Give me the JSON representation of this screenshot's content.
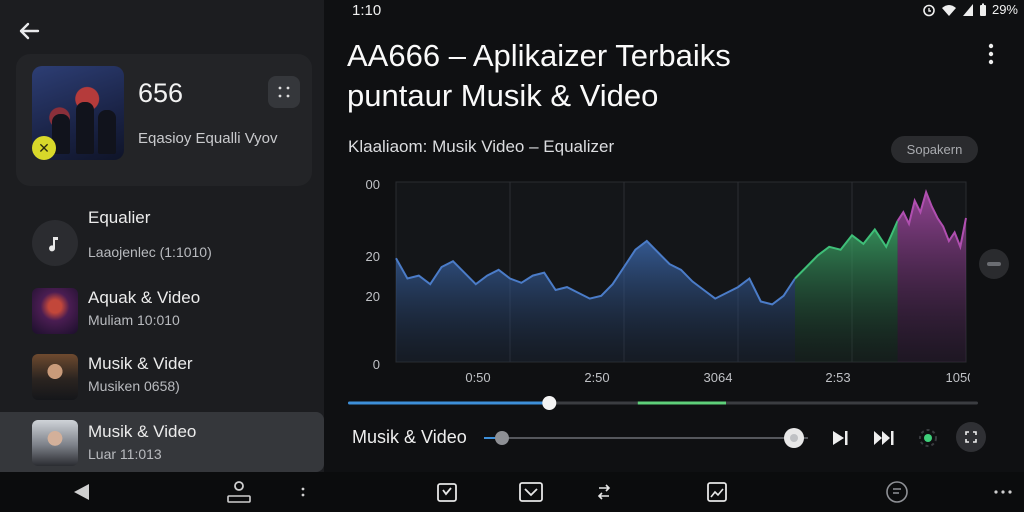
{
  "status": {
    "time": "1:10",
    "battery": "29%"
  },
  "now_playing": {
    "title": "656",
    "subtitle": "Eqasioy Equalli Vyov"
  },
  "list": [
    {
      "title": "Equalier",
      "subtitle": "Laaojenlec (1:1010)",
      "thumb": "music-note-icon"
    },
    {
      "title": "Aquak & Video",
      "subtitle": "Muliam 10:010",
      "thumb": "concert-thumb"
    },
    {
      "title": "Musik & Vider",
      "subtitle": "Musiken 0658)",
      "thumb": "portrait-thumb"
    },
    {
      "title": "Musik & Video",
      "subtitle": "Luar 11:013",
      "thumb": "portrait-thumb"
    }
  ],
  "header": {
    "title": "AA666 – Aplikaizer Terbaiks puntaur Musik & Video",
    "subtitle": "Klaaliaom: Musik Video – Equalizer",
    "chip": "Sopakern"
  },
  "chart_data": {
    "type": "area",
    "y_tick_labels": [
      "00",
      "20",
      "20",
      "0"
    ],
    "x_tick_labels": [
      "0:50",
      "2:50",
      "3064",
      "2:53",
      "1050"
    ],
    "grid": true,
    "series": [
      {
        "color": "#4b7cc8",
        "x": [
          0,
          2,
          4,
          6,
          8,
          10,
          12,
          14,
          16,
          18,
          20,
          22,
          24,
          26,
          28,
          30,
          32,
          34,
          36,
          38,
          40,
          42,
          44,
          46,
          48,
          50,
          52,
          54,
          56,
          58,
          60,
          62,
          64,
          66,
          68,
          70
        ],
        "y": [
          72,
          58,
          60,
          54,
          66,
          70,
          62,
          54,
          60,
          64,
          58,
          55,
          60,
          62,
          50,
          52,
          48,
          44,
          46,
          54,
          66,
          78,
          84,
          76,
          68,
          64,
          56,
          50,
          44,
          48,
          52,
          58,
          42,
          40,
          46,
          58
        ]
      },
      {
        "color": "#3fbf78",
        "x": [
          70,
          72,
          74,
          76,
          78,
          80,
          82,
          84,
          86,
          88
        ],
        "y": [
          58,
          66,
          74,
          80,
          78,
          88,
          82,
          92,
          80,
          98
        ]
      },
      {
        "color": "#b04fb0",
        "x": [
          88,
          89,
          90,
          91,
          92,
          93,
          94,
          95,
          96,
          97,
          98,
          99,
          100
        ],
        "y": [
          98,
          104,
          96,
          112,
          104,
          118,
          108,
          100,
          94,
          84,
          90,
          80,
          100
        ]
      }
    ],
    "ylim": [
      0,
      125
    ],
    "xlim": [
      0,
      100
    ]
  },
  "progress": {
    "fraction": 0.31,
    "segment_start": 0.46,
    "segment_end": 0.6
  },
  "player": {
    "label": "Musik & Video",
    "fraction": 0.0
  },
  "colors": {
    "accent": "#3d8fd9",
    "segment": "#5fd07a",
    "panel": "#1c1d20"
  }
}
